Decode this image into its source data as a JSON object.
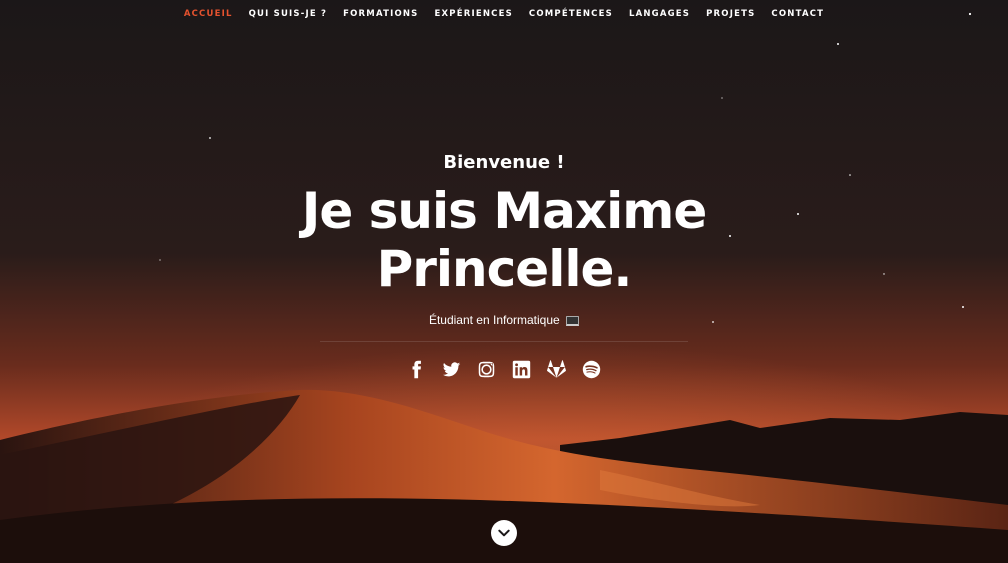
{
  "nav": {
    "items": [
      {
        "label": "ACCUEIL",
        "active": true
      },
      {
        "label": "QUI SUIS-JE ?",
        "active": false
      },
      {
        "label": "FORMATIONS",
        "active": false
      },
      {
        "label": "EXPÉRIENCES",
        "active": false
      },
      {
        "label": "COMPÉTENCES",
        "active": false
      },
      {
        "label": "LANGAGES",
        "active": false
      },
      {
        "label": "PROJETS",
        "active": false
      },
      {
        "label": "CONTACT",
        "active": false
      }
    ],
    "active_color": "#e5522e"
  },
  "hero": {
    "welcome": "Bienvenue !",
    "name_line1": "Je suis Maxime",
    "name_line2": "Princelle.",
    "subtitle": "Étudiant en Informatique",
    "subtitle_icon": "laptop-icon"
  },
  "socials": [
    "facebook-icon",
    "twitter-icon",
    "instagram-icon",
    "linkedin-icon",
    "gitlab-icon",
    "spotify-icon"
  ],
  "scroll_icon": "chevron-down-icon",
  "colors": {
    "background": "#1b1718",
    "dune": "#c8532a",
    "accent": "#e5522e"
  }
}
